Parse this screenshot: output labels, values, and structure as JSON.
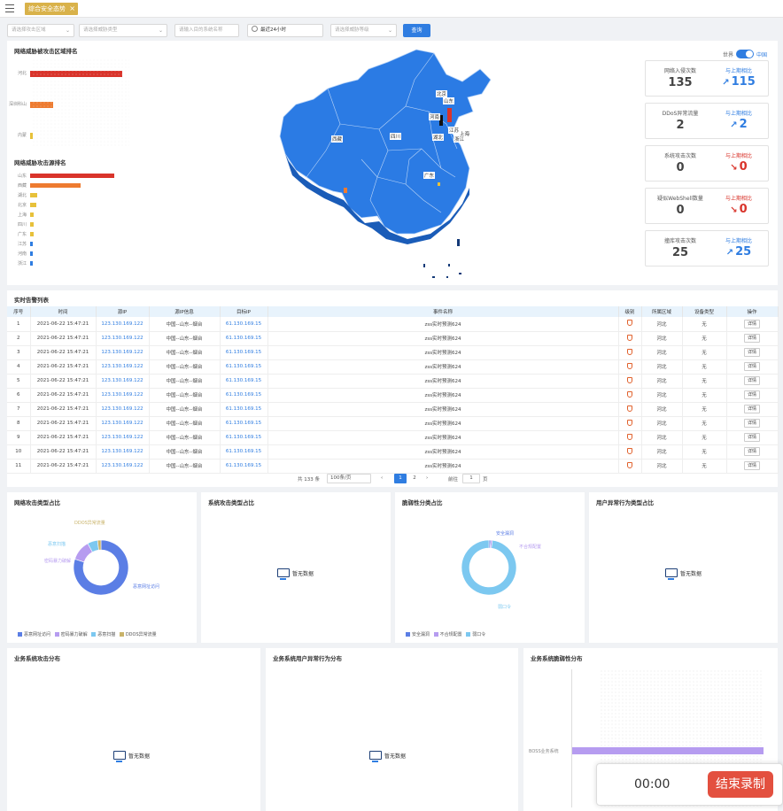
{
  "tabbar": {
    "menu_icon": "hamburger-menu-icon",
    "active_tab": "综合安全态势",
    "close_icon": "close-icon"
  },
  "filters": {
    "f1_placeholder": "请选择攻击区域",
    "f2_placeholder": "请选择威胁类型",
    "f3_placeholder": "请输入目的系统名称",
    "time_value": "最近24小时",
    "f5_placeholder": "请选择威胁等级",
    "query_label": "查询"
  },
  "colors": {
    "accent": "#2f7de1",
    "map_fill": "#2b7be4",
    "bar_red": "#d9342b",
    "bar_orange": "#ee7b30",
    "bar_yellow": "#e7c13a",
    "bar_blue": "#2f7de1",
    "tab_gold": "#d9b24a"
  },
  "attacked_region_rank": {
    "title": "网络威胁被攻击区域排名",
    "items": [
      {
        "label": "河北",
        "value": 100,
        "color": "#d9342b"
      },
      {
        "label": "深圳科山",
        "value": 25,
        "color": "#ee7b30"
      },
      {
        "label": "内蒙",
        "value": 3,
        "color": "#e7c13a"
      }
    ]
  },
  "source_rank": {
    "title": "网络威胁攻击源排名",
    "items": [
      {
        "label": "山东",
        "value": 100,
        "color": "#d9342b"
      },
      {
        "label": "西藏",
        "value": 60,
        "color": "#ee7b30"
      },
      {
        "label": "湖北",
        "value": 8,
        "color": "#e7c13a"
      },
      {
        "label": "北京",
        "value": 7,
        "color": "#e7c13a"
      },
      {
        "label": "上海",
        "value": 4,
        "color": "#e7c13a"
      },
      {
        "label": "四川",
        "value": 4,
        "color": "#e7c13a"
      },
      {
        "label": "广东",
        "value": 4,
        "color": "#e7c13a"
      },
      {
        "label": "江苏",
        "value": 3,
        "color": "#2f7de1"
      },
      {
        "label": "河南",
        "value": 3,
        "color": "#2f7de1"
      },
      {
        "label": "浙江",
        "value": 3,
        "color": "#2f7de1"
      }
    ]
  },
  "map": {
    "toggle_left": "世界",
    "toggle_right": "中国",
    "labels": [
      "北京",
      "山东",
      "河南",
      "西藏",
      "四川",
      "湖北",
      "江苏",
      "上海",
      "浙江",
      "广东"
    ]
  },
  "stats": [
    {
      "label": "网络入侵次数",
      "value": "135",
      "compare_label": "与上期相比",
      "compare_value": "115",
      "trend": "up"
    },
    {
      "label": "DDoS异常流量",
      "value": "2",
      "compare_label": "与上期相比",
      "compare_value": "2",
      "trend": "up"
    },
    {
      "label": "系统攻击次数",
      "value": "0",
      "compare_label": "与上期相比",
      "compare_value": "0",
      "trend": "down"
    },
    {
      "label": "疑似WebShell数量",
      "value": "0",
      "compare_label": "与上期相比",
      "compare_value": "0",
      "trend": "down"
    },
    {
      "label": "撞库攻击次数",
      "value": "25",
      "compare_label": "与上期相比",
      "compare_value": "25",
      "trend": "up"
    }
  ],
  "alerts": {
    "title": "实时告警列表",
    "columns": [
      "序号",
      "时间",
      "源IP",
      "源IP信息",
      "目标IP",
      "事件名称",
      "级别",
      "所属区域",
      "设备类型",
      "操作"
    ],
    "rows": [
      [
        "1",
        "2021-06-22 15:47:21",
        "123.130.169.122",
        "中国--山东--烟台",
        "61.130.169.15",
        "zss实时预测624",
        "",
        "河北",
        "无",
        "详情"
      ],
      [
        "2",
        "2021-06-22 15:47:21",
        "123.130.169.122",
        "中国--山东--烟台",
        "61.130.169.15",
        "zss实时预测624",
        "",
        "河北",
        "无",
        "详情"
      ],
      [
        "3",
        "2021-06-22 15:47:21",
        "123.130.169.122",
        "中国--山东--烟台",
        "61.130.169.15",
        "zss实时预测624",
        "",
        "河北",
        "无",
        "详情"
      ],
      [
        "4",
        "2021-06-22 15:47:21",
        "123.130.169.122",
        "中国--山东--烟台",
        "61.130.169.15",
        "zss实时预测624",
        "",
        "河北",
        "无",
        "详情"
      ],
      [
        "5",
        "2021-06-22 15:47:21",
        "123.130.169.122",
        "中国--山东--烟台",
        "61.130.169.15",
        "zss实时预测624",
        "",
        "河北",
        "无",
        "详情"
      ],
      [
        "6",
        "2021-06-22 15:47:21",
        "123.130.169.122",
        "中国--山东--烟台",
        "61.130.169.15",
        "zss实时预测624",
        "",
        "河北",
        "无",
        "详情"
      ],
      [
        "7",
        "2021-06-22 15:47:21",
        "123.130.169.122",
        "中国--山东--烟台",
        "61.130.169.15",
        "zss实时预测624",
        "",
        "河北",
        "无",
        "详情"
      ],
      [
        "8",
        "2021-06-22 15:47:21",
        "123.130.169.122",
        "中国--山东--烟台",
        "61.130.169.15",
        "zss实时预测624",
        "",
        "河北",
        "无",
        "详情"
      ],
      [
        "9",
        "2021-06-22 15:47:21",
        "123.130.169.122",
        "中国--山东--烟台",
        "61.130.169.15",
        "zss实时预测624",
        "",
        "河北",
        "无",
        "详情"
      ],
      [
        "10",
        "2021-06-22 15:47:21",
        "123.130.169.122",
        "中国--山东--烟台",
        "61.130.169.15",
        "zss实时预测624",
        "",
        "河北",
        "无",
        "详情"
      ],
      [
        "11",
        "2021-06-22 15:47:21",
        "123.130.169.122",
        "中国--山东--烟台",
        "61.130.169.15",
        "zss实时预测624",
        "",
        "河北",
        "无",
        "详情"
      ]
    ],
    "pager": {
      "total": "共 133 条",
      "page_size": "100条/页",
      "pages": [
        "1",
        "2"
      ],
      "goto_label": "前往",
      "goto_value": "1",
      "page_unit": "页"
    }
  },
  "charts": {
    "network_attack_type": {
      "title": "网络攻击类型占比",
      "labels": [
        "DDOS异常流量",
        "恶意扫描",
        "密码暴力破解",
        "恶意网址访问"
      ],
      "legend": [
        "恶意网址访问",
        "密码暴力破解",
        "恶意扫描",
        "DDOS异常流量"
      ]
    },
    "system_attack_type": {
      "title": "系统攻击类型占比",
      "nodata": "暂无数据"
    },
    "vuln_type": {
      "title": "脆弱性分类占比",
      "labels": [
        "安全漏洞",
        "不合规配置",
        "弱口令"
      ],
      "legend": [
        "安全漏洞",
        "不合规配置",
        "弱口令"
      ]
    },
    "user_behavior_type": {
      "title": "用户异常行为类型占比",
      "nodata": "暂无数据"
    },
    "biz_attack_dist": {
      "title": "业务系统攻击分布",
      "nodata": "暂无数据"
    },
    "biz_user_behavior_dist": {
      "title": "业务系统用户异常行为分布",
      "nodata": "暂无数据"
    },
    "biz_vuln_dist": {
      "title": "业务系统脆弱性分布",
      "category": "BOSS业务系统"
    }
  },
  "chart_data": [
    {
      "type": "pie",
      "title": "网络攻击类型占比",
      "categories": [
        "恶意网址访问",
        "密码暴力破解",
        "恶意扫描",
        "DDOS异常流量"
      ],
      "values": [
        80,
        12,
        6,
        2
      ]
    },
    {
      "type": "pie",
      "title": "脆弱性分类占比",
      "categories": [
        "安全漏洞",
        "不合规配置",
        "弱口令"
      ],
      "values": [
        1,
        1,
        98
      ]
    },
    {
      "type": "bar",
      "title": "业务系统脆弱性分布",
      "categories": [
        "BOSS业务系统"
      ],
      "values": [
        100
      ]
    }
  ],
  "recorder": {
    "time": "00:00",
    "stop_label": "结束录制"
  }
}
